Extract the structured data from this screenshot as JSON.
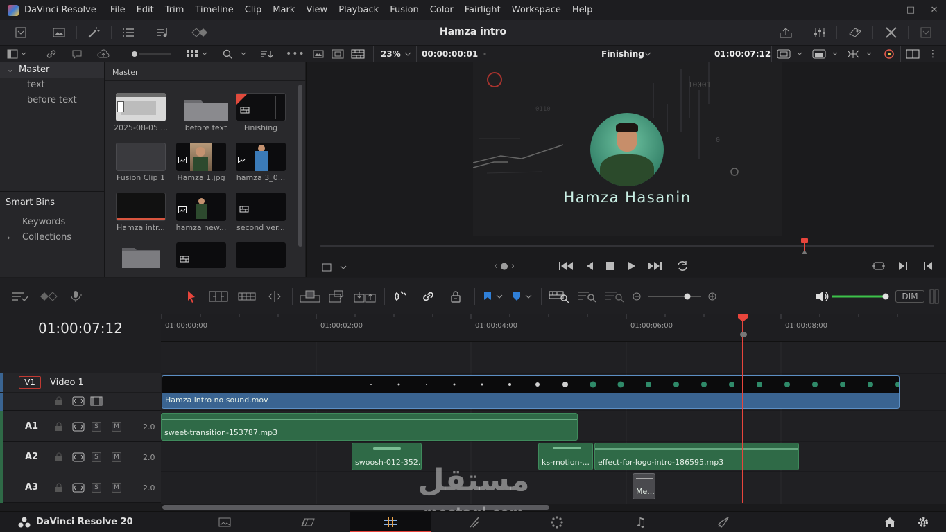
{
  "app": {
    "title": "DaVinci Resolve",
    "menu": [
      "File",
      "Edit",
      "Trim",
      "Timeline",
      "Clip",
      "Mark",
      "View",
      "Playback",
      "Fusion",
      "Color",
      "Fairlight",
      "Workspace",
      "Help"
    ],
    "project_name": "Hamza intro",
    "bottom_brand": "DaVinci Resolve 20"
  },
  "viewer": {
    "zoom": "23%",
    "source_timecode": "00:00:00:01",
    "timeline_name": "Finishing",
    "record_timecode": "01:00:07:12",
    "overlay_name": "Hamza Hasanin"
  },
  "bins": {
    "master": "Master",
    "items": [
      "text",
      "before text"
    ],
    "smart_bins": "Smart Bins",
    "smart_items": [
      "Keywords",
      "Collections"
    ]
  },
  "media_pool": {
    "header": "Master",
    "clips": [
      {
        "label": "2025-08-05 ...",
        "kind": "screen"
      },
      {
        "label": "before text",
        "kind": "folder"
      },
      {
        "label": "Finishing",
        "kind": "timeline"
      },
      {
        "label": "Fusion Clip 1",
        "kind": "fusion"
      },
      {
        "label": "Hamza 1.jpg",
        "kind": "photo"
      },
      {
        "label": "hamza 3_0...",
        "kind": "photo"
      },
      {
        "label": "Hamza intr...",
        "kind": "video"
      },
      {
        "label": "hamza new...",
        "kind": "photo"
      },
      {
        "label": "second ver...",
        "kind": "timeline"
      },
      {
        "label": "",
        "kind": "folder"
      },
      {
        "label": "",
        "kind": "timeline"
      },
      {
        "label": "",
        "kind": "video"
      }
    ]
  },
  "timeline": {
    "timecode": "01:00:07:12",
    "ruler": [
      "01:00:00:00",
      "01:00:02:00",
      "01:00:04:00",
      "01:00:06:00",
      "01:00:08:00"
    ],
    "dim_label": "DIM",
    "tracks": [
      {
        "id": "V1",
        "name": "Video 1"
      },
      {
        "id": "A1",
        "level": "2.0"
      },
      {
        "id": "A2",
        "level": "2.0"
      },
      {
        "id": "A3",
        "level": "2.0"
      }
    ],
    "solo": "S",
    "mute": "M",
    "clips": {
      "v1": "Hamza intro no sound.mov",
      "a1": "sweet-transition-153787.mp3",
      "a2a": "swoosh-012-352...",
      "a2b": "ks-motion-...",
      "a2c": "effect-for-logo-intro-186595.mp3",
      "a3": "Me..."
    }
  },
  "watermark": {
    "arabic": "مستقل",
    "latin": "mostaql.com"
  },
  "colors": {
    "accent_red": "#e8453c",
    "video_clip": "#3a6491",
    "audio_clip": "#2f6a47",
    "volume": "#3cc24a"
  }
}
